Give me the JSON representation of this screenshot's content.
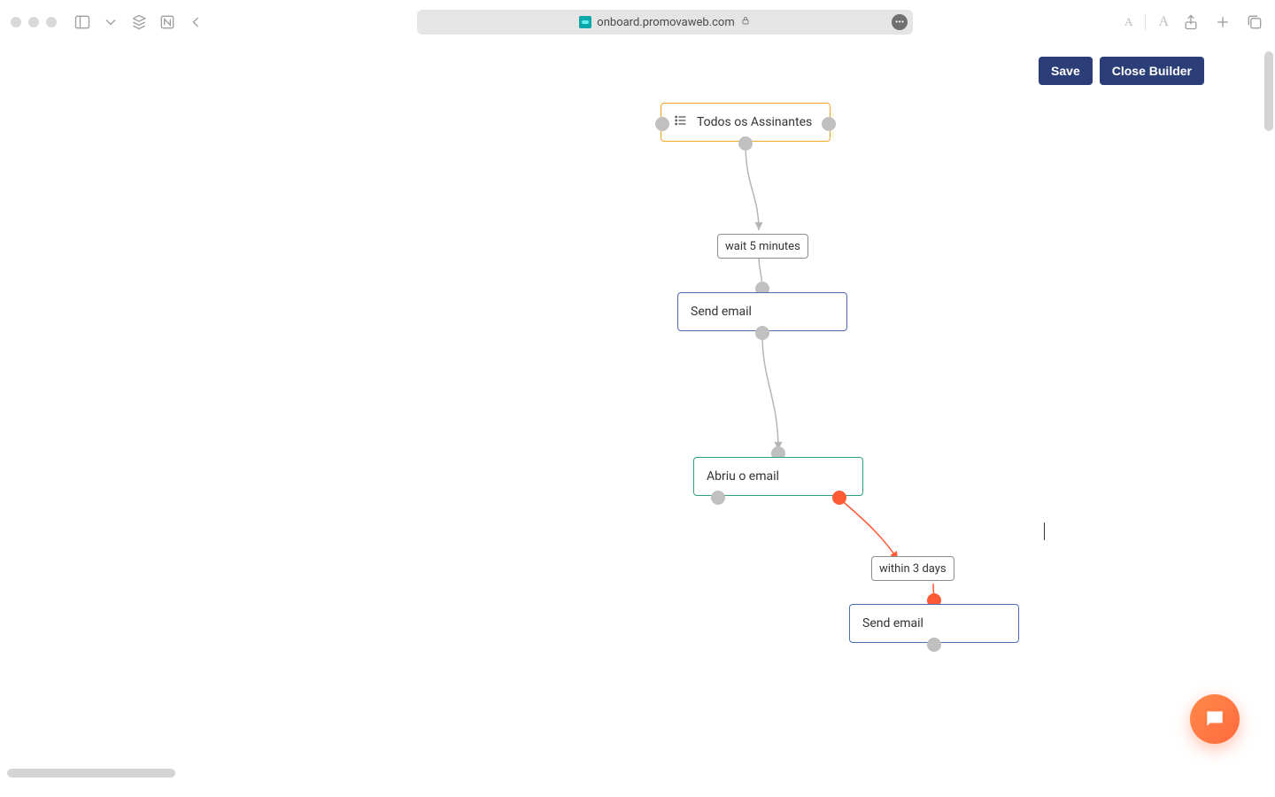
{
  "browser": {
    "url_text": "onboard.promovaweb.com"
  },
  "actions": {
    "save": "Save",
    "close": "Close Builder"
  },
  "flow": {
    "start": {
      "label": "Todos os Assinantes"
    },
    "wait1": {
      "label": "wait 5 minutes"
    },
    "send1": {
      "label": "Send email"
    },
    "cond1": {
      "label": "Abriu o email"
    },
    "wait2": {
      "label": "within 3 days"
    },
    "send2": {
      "label": "Send email"
    }
  }
}
